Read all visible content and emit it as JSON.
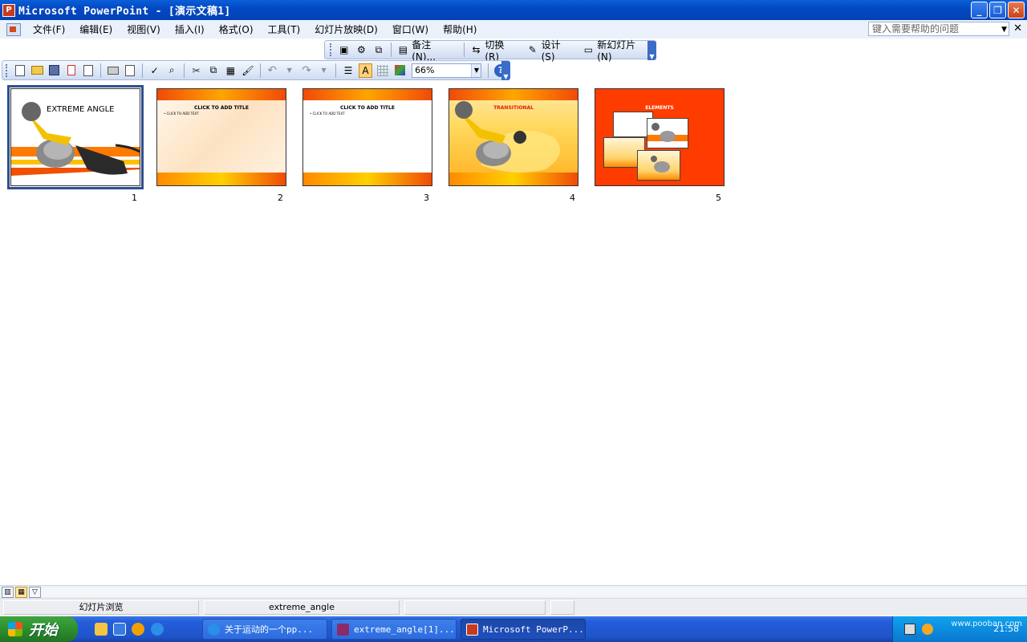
{
  "window": {
    "title": "Microsoft PowerPoint - [演示文稿1]",
    "app_icon_letter": "P"
  },
  "menu": {
    "items": [
      "文件(F)",
      "编辑(E)",
      "视图(V)",
      "插入(I)",
      "格式(O)",
      "工具(T)",
      "幻灯片放映(D)",
      "窗口(W)",
      "帮助(H)"
    ],
    "help_placeholder": "键入需要帮助的问题"
  },
  "sorter_toolbar": {
    "notes_label": "备注(N)...",
    "transition_label": "切换(R)",
    "design_label": "设计(S)",
    "new_slide_label": "新幻灯片(N)"
  },
  "standard_toolbar": {
    "zoom": "66%"
  },
  "slides": [
    {
      "number": "1",
      "title": "EXTREME ANGLE",
      "selected": true
    },
    {
      "number": "2",
      "title": "CLICK TO ADD TITLE",
      "bullet": "• CLICK TO ADD TEXT"
    },
    {
      "number": "3",
      "title": "CLICK TO ADD TITLE",
      "bullet": "• CLICK TO ADD TEXT"
    },
    {
      "number": "4",
      "title": "TRANSITIONAL"
    },
    {
      "number": "5",
      "title": "ELEMENTS"
    }
  ],
  "status": {
    "view": "幻灯片浏览",
    "design": "extreme_angle"
  },
  "taskbar": {
    "start": "开始",
    "tasks": [
      "关于运动的一个pp...",
      "extreme_angle[1]...",
      "Microsoft PowerP..."
    ],
    "clock": "21:58",
    "watermark": "www.pooban.com"
  },
  "colors": {
    "titlebar": "#0349c4",
    "slide_orange": "#ff3c00",
    "slide_yellow": "#ffd000"
  }
}
